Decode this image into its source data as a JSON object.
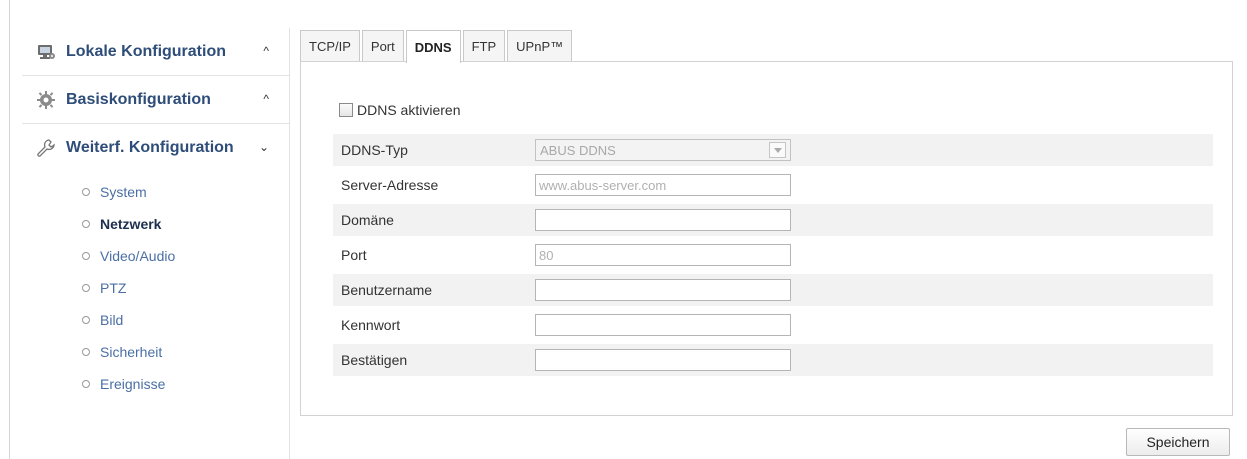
{
  "sidebar": {
    "sections": [
      {
        "label": "Lokale Konfiguration",
        "icon": "monitor-settings-icon",
        "state": "collapsed"
      },
      {
        "label": "Basiskonfiguration",
        "icon": "gear-icon",
        "state": "collapsed"
      },
      {
        "label": "Weiterf. Konfiguration",
        "icon": "wrench-icon",
        "state": "expanded"
      }
    ],
    "chevrons": {
      "collapsed": "^",
      "expanded": "⌄"
    },
    "items": [
      {
        "label": "System",
        "active": false
      },
      {
        "label": "Netzwerk",
        "active": true
      },
      {
        "label": "Video/Audio",
        "active": false
      },
      {
        "label": "PTZ",
        "active": false
      },
      {
        "label": "Bild",
        "active": false
      },
      {
        "label": "Sicherheit",
        "active": false
      },
      {
        "label": "Ereignisse",
        "active": false
      }
    ]
  },
  "tabs": [
    {
      "label": "TCP/IP",
      "active": false
    },
    {
      "label": "Port",
      "active": false
    },
    {
      "label": "DDNS",
      "active": true
    },
    {
      "label": "FTP",
      "active": false
    },
    {
      "label": "UPnP™",
      "active": false
    }
  ],
  "form": {
    "enable_label": "DDNS aktivieren",
    "enable_checked": false,
    "ddns_type": {
      "label": "DDNS-Typ",
      "value": "ABUS DDNS"
    },
    "server": {
      "label": "Server-Adresse",
      "placeholder": "www.abus-server.com",
      "value": ""
    },
    "domain": {
      "label": "Domäne",
      "value": ""
    },
    "port": {
      "label": "Port",
      "placeholder": "80",
      "value": ""
    },
    "username": {
      "label": "Benutzername",
      "value": ""
    },
    "password": {
      "label": "Kennwort",
      "value": ""
    },
    "confirm": {
      "label": "Bestätigen",
      "value": ""
    }
  },
  "save_label": "Speichern",
  "colors": {
    "section_title": "#2e4d79",
    "sub_item": "#4a6fa5",
    "row_shade": "#f2f2f2"
  }
}
